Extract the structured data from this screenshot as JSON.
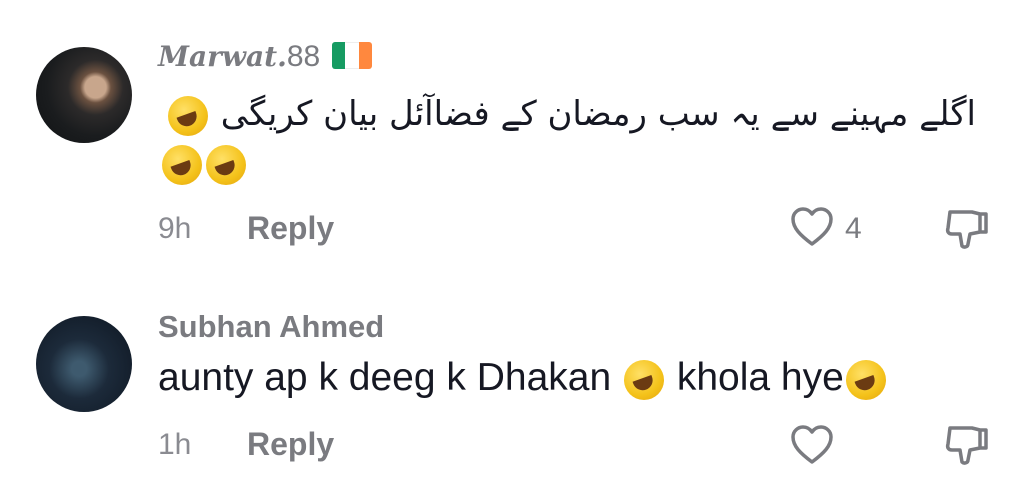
{
  "comments": [
    {
      "username_text": "Marwat.",
      "username_num": "88",
      "text": "اگلے مہینے سے یہ سب رمضان کے فضاآئل بیان کریگی",
      "time": "9h",
      "reply_label": "Reply",
      "like_count": "4",
      "emoji_icon": "rolling-on-floor-laughing-icon",
      "flag_colors": [
        "#169b62",
        "#ffffff",
        "#ff883e"
      ]
    },
    {
      "username": "Subhan Ahmed",
      "text_part1": "aunty ap k deeg k Dhakan ",
      "text_part2": " khola hye",
      "time": "1h",
      "reply_label": "Reply",
      "emoji_icon": "rolling-on-floor-laughing-icon"
    }
  ]
}
